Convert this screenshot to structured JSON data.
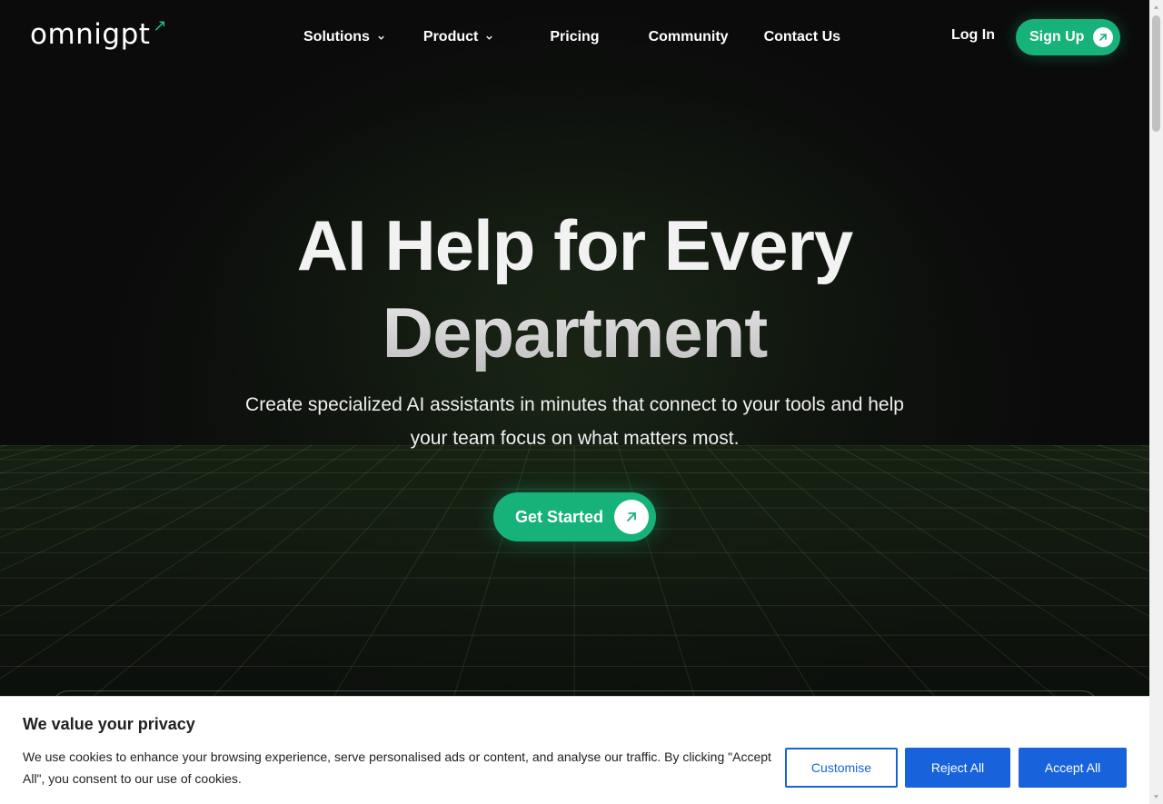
{
  "header": {
    "logo_text": "omnigpt",
    "logo_arrow": "↗",
    "nav": [
      {
        "label": "Solutions",
        "has_dropdown": true
      },
      {
        "label": "Product",
        "has_dropdown": true
      },
      {
        "label": "Pricing",
        "has_dropdown": false
      },
      {
        "label": "Community",
        "has_dropdown": false
      },
      {
        "label": "Contact Us",
        "has_dropdown": false
      }
    ],
    "login_label": "Log In",
    "signup_label": "Sign Up",
    "signup_icon": "arrow-up-right-icon"
  },
  "hero": {
    "title_line1": "AI Help for Every",
    "title_line2": "Department",
    "subtitle": "Create specialized AI assistants in minutes that connect to your tools and help your team focus on what matters most.",
    "cta_label": "Get Started",
    "cta_icon": "arrow-up-right-icon"
  },
  "cookie_banner": {
    "title": "We value your privacy",
    "text": "We use cookies to enhance your browsing experience, serve personalised ads or content, and analyse our traffic. By clicking \"Accept All\", you consent to our use of cookies.",
    "customise_label": "Customise",
    "reject_label": "Reject All",
    "accept_label": "Accept All"
  },
  "colors": {
    "accent_green": "#17b27a",
    "cookie_blue": "#1863dc",
    "background": "#0d0d0d"
  }
}
